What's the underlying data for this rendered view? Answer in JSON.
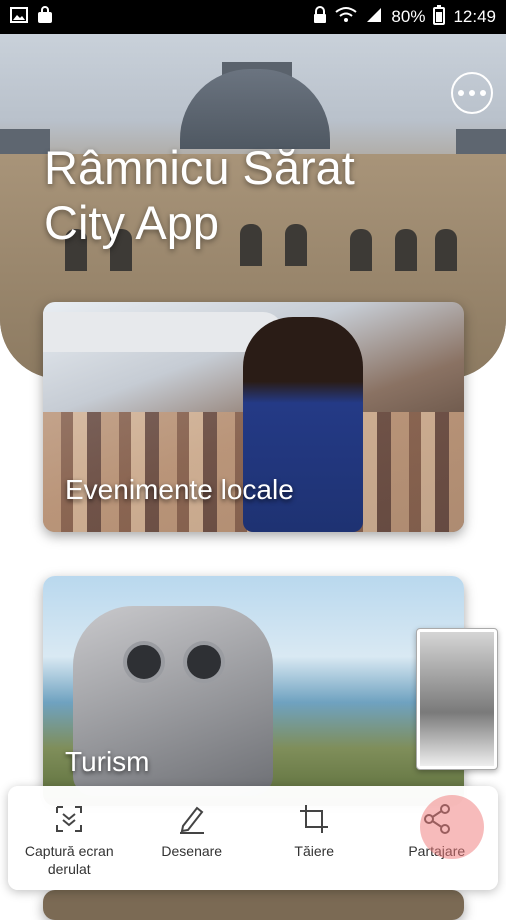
{
  "status_bar": {
    "battery": "80%",
    "time": "12:49",
    "icons": [
      "image-icon",
      "bag-icon",
      "lock-icon",
      "wifi-icon",
      "signal-icon",
      "battery-icon"
    ]
  },
  "hero": {
    "title": "Râmnicu Sărat\nCity App",
    "menu_icon": "more-horizontal-icon"
  },
  "cards": [
    {
      "label": "Evenimente locale"
    },
    {
      "label": "Turism"
    }
  ],
  "toolbar": {
    "items": [
      {
        "label": "Captură ecran derulat",
        "icon": "scroll-capture-icon"
      },
      {
        "label": "Desenare",
        "icon": "pen-icon"
      },
      {
        "label": "Tăiere",
        "icon": "crop-icon"
      },
      {
        "label": "Partajare",
        "icon": "share-icon"
      }
    ]
  },
  "colors": {
    "status_bar": "#000000",
    "toolbar_bg": "#ffffff",
    "text": "#333333"
  }
}
